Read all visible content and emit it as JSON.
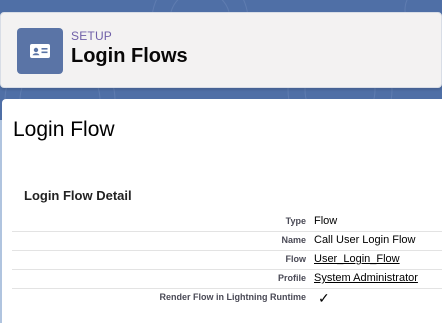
{
  "header": {
    "eyebrow": "SETUP",
    "title": "Login Flows",
    "icon": "contact-card-icon"
  },
  "content": {
    "title": "Login Flow",
    "section_title": "Login Flow Detail",
    "rows": [
      {
        "label": "Type",
        "value": "Flow",
        "link": false
      },
      {
        "label": "Name",
        "value": "Call User Login Flow",
        "link": false
      },
      {
        "label": "Flow",
        "value": "User_Login_Flow",
        "link": true
      },
      {
        "label": "Profile",
        "value": "System Administrator",
        "link": true
      },
      {
        "label": "Render Flow in Lightning Runtime",
        "value": "✓",
        "checkbox": true,
        "checked": true
      }
    ]
  },
  "colors": {
    "band": "#4f6fa6",
    "icon_bg": "#5a74a6",
    "eyebrow": "#6f5fa8"
  }
}
